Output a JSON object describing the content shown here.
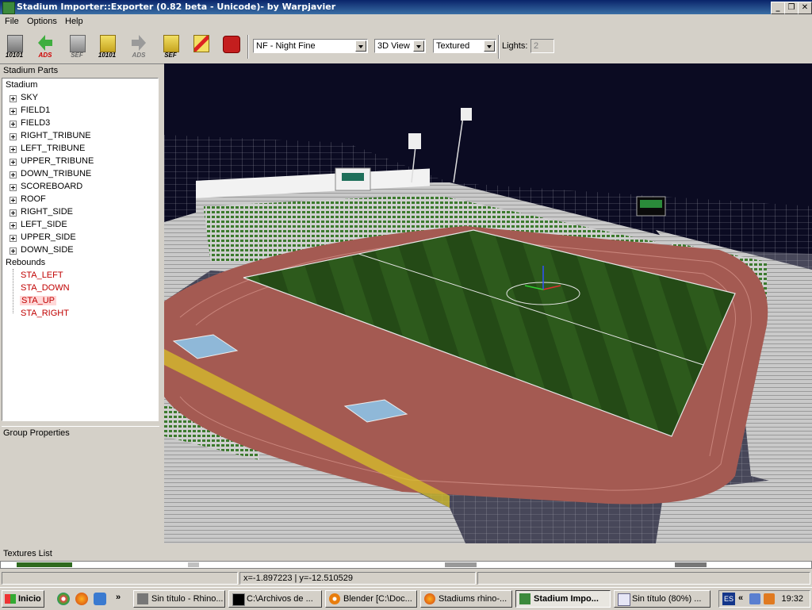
{
  "window": {
    "title": "Stadium Importer::Exporter (0.82 beta - Unicode)- by Warpjavier"
  },
  "menu": [
    "File",
    "Options",
    "Help"
  ],
  "toolbar": {
    "buttons": [
      {
        "name": "import-10101",
        "label": "10101"
      },
      {
        "name": "import-ads",
        "label": "ADS"
      },
      {
        "name": "import-sef",
        "label": "SEF"
      },
      {
        "name": "export-10101",
        "label": "10101"
      },
      {
        "name": "export-ads",
        "label": "ADS"
      },
      {
        "name": "export-sef",
        "label": "SEF"
      },
      {
        "name": "clear",
        "label": ""
      },
      {
        "name": "exit",
        "label": ""
      }
    ],
    "weather_value": "NF - Night Fine",
    "view_value": "3D View",
    "render_value": "Textured",
    "lights_label": "Lights:",
    "lights_value": "2"
  },
  "left_panel": {
    "parts_header": "Stadium Parts",
    "props_header": "Group Properties",
    "stadium_root": "Stadium",
    "stadium_items": [
      "SKY",
      "FIELD1",
      "FIELD3",
      "RIGHT_TRIBUNE",
      "LEFT_TRIBUNE",
      "UPPER_TRIBUNE",
      "DOWN_TRIBUNE",
      "SCOREBOARD",
      "ROOF",
      "RIGHT_SIDE",
      "LEFT_SIDE",
      "UPPER_SIDE",
      "DOWN_SIDE"
    ],
    "rebounds_root": "Rebounds",
    "rebound_items": [
      "STA_LEFT",
      "STA_DOWN",
      "STA_UP",
      "STA_RIGHT"
    ],
    "selected_rebound": "STA_UP"
  },
  "textures_header": "Textures List",
  "status": {
    "coords": "x=-1.897223 | y=-12.510529"
  },
  "taskbar": {
    "start_label": "Inicio",
    "tasks": [
      {
        "label": "Sin título - Rhino...",
        "active": false
      },
      {
        "label": "C:\\Archivos de ...",
        "active": false
      },
      {
        "label": "Blender [C:\\Doc...",
        "active": false
      },
      {
        "label": "Stadiums rhino-...",
        "active": false
      },
      {
        "label": "Stadium Impo...",
        "active": true
      },
      {
        "label": "Sin título (80%) ...",
        "active": false
      }
    ],
    "lang": "ES",
    "clock": "19:32"
  },
  "colors": {
    "titlebar": "#0a246a",
    "field": "#2f5a1d",
    "track": "#a45a52",
    "sky": "#0b0b22",
    "rebound_text": "#c00000"
  }
}
